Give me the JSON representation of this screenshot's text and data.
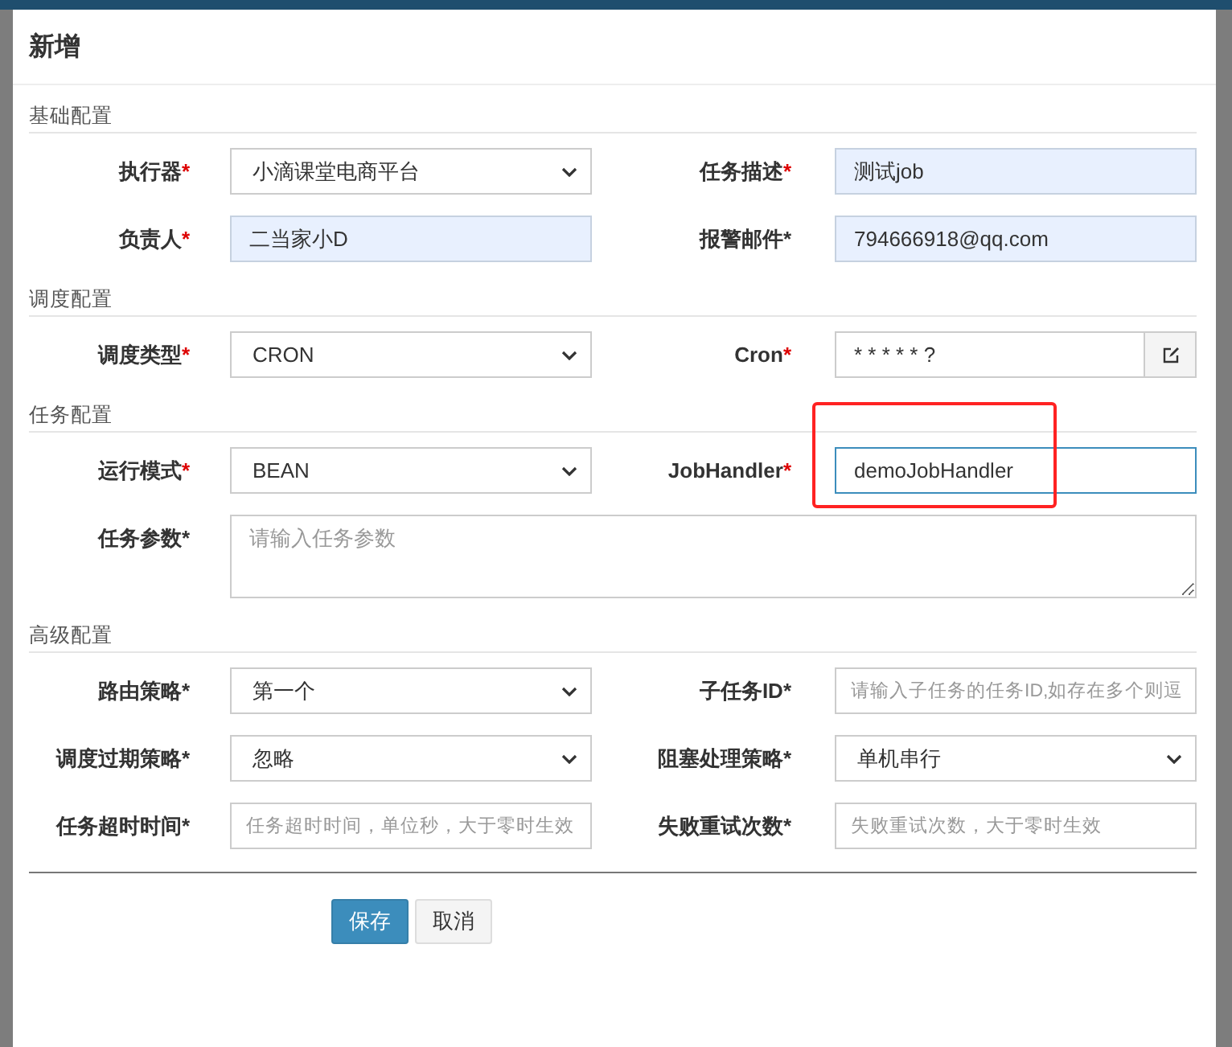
{
  "modal": {
    "title": "新增"
  },
  "sections": [
    {
      "title": "基础配置",
      "fields": [
        {
          "label": "执行器",
          "star": "*",
          "star_red": true,
          "kind": "select",
          "value": "小滴课堂电商平台"
        },
        {
          "label": "任务描述",
          "star": "*",
          "star_red": true,
          "kind": "text",
          "value": "测试job",
          "autofilled": true
        },
        {
          "label": "负责人",
          "star": "*",
          "star_red": true,
          "kind": "text",
          "value": "二当家小D",
          "autofilled": true
        },
        {
          "label": "报警邮件",
          "star": "*",
          "star_red": false,
          "kind": "text",
          "value": "794666918@qq.com",
          "autofilled": true
        }
      ]
    },
    {
      "title": "调度配置",
      "fields": [
        {
          "label": "调度类型",
          "star": "*",
          "star_red": true,
          "kind": "select",
          "value": "CRON"
        },
        {
          "label": "Cron",
          "star": "*",
          "star_red": true,
          "kind": "addon",
          "value": "* * * * * ?"
        }
      ]
    },
    {
      "title": "任务配置",
      "fields": [
        {
          "label": "运行模式",
          "star": "*",
          "star_red": true,
          "kind": "select",
          "value": "BEAN"
        },
        {
          "label": "JobHandler",
          "star": "*",
          "star_red": true,
          "kind": "text",
          "value": "demoJobHandler",
          "focused": true,
          "highlighted": true
        },
        {
          "label": "任务参数",
          "star": "*",
          "star_red": false,
          "kind": "textarea",
          "placeholder": "请输入任务参数"
        }
      ]
    },
    {
      "title": "高级配置",
      "fields": [
        {
          "label": "路由策略",
          "star": "*",
          "star_red": false,
          "kind": "select",
          "value": "第一个"
        },
        {
          "label": "子任务ID",
          "star": "*",
          "star_red": false,
          "kind": "text",
          "placeholder": "请输入子任务的任务ID,如存在多个则逗"
        },
        {
          "label": "调度过期策略",
          "star": "*",
          "star_red": false,
          "kind": "select",
          "value": "忽略"
        },
        {
          "label": "阻塞处理策略",
          "star": "*",
          "star_red": false,
          "kind": "select",
          "value": "单机串行"
        },
        {
          "label": "任务超时时间",
          "star": "*",
          "star_red": false,
          "kind": "text",
          "placeholder": "任务超时时间，单位秒，大于零时生效"
        },
        {
          "label": "失败重试次数",
          "star": "*",
          "star_red": false,
          "kind": "text",
          "placeholder": "失败重试次数，大于零时生效"
        }
      ]
    }
  ],
  "buttons": [
    {
      "label": "保存",
      "kind": "primary"
    },
    {
      "label": "取消",
      "kind": "default"
    }
  ]
}
